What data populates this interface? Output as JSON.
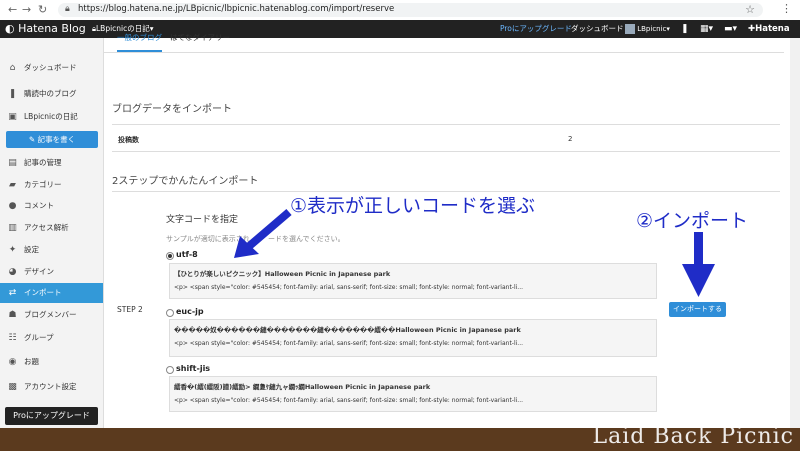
{
  "browser": {
    "url": "https://blog.hatena.ne.jp/LBpicnic/lbpicnic.hatenablog.com/import/reserve"
  },
  "header": {
    "logo": "Hatena Blog",
    "blog_name": "LBpicnicの日記",
    "pro_upgrade": "Proにアップグレード",
    "dashboard": "ダッシュボード",
    "user": "LBpicnic",
    "hatena": "Hatena"
  },
  "sidebar": {
    "items": [
      {
        "label": "ダッシュボード",
        "icon": "home-icon"
      },
      {
        "label": "購読中のブログ",
        "icon": "bookmark-icon"
      },
      {
        "label": "LBpicnicの日記",
        "icon": "blog-icon"
      },
      {
        "label": "記事の管理",
        "icon": "document-icon"
      },
      {
        "label": "カテゴリー",
        "icon": "folder-icon"
      },
      {
        "label": "コメント",
        "icon": "comment-icon"
      },
      {
        "label": "アクセス解析",
        "icon": "chart-icon"
      },
      {
        "label": "設定",
        "icon": "wrench-icon"
      },
      {
        "label": "デザイン",
        "icon": "palette-icon"
      },
      {
        "label": "インポート",
        "icon": "import-icon"
      },
      {
        "label": "ブログメンバー",
        "icon": "members-icon"
      },
      {
        "label": "グループ",
        "icon": "group-icon"
      },
      {
        "label": "お題",
        "icon": "topic-icon"
      },
      {
        "label": "アカウント設定",
        "icon": "account-icon"
      }
    ],
    "write_button": "記事を書く",
    "pro_button": "Proにアップグレード"
  },
  "main": {
    "tabs": [
      "一般のブログ",
      "はてなダイアリー"
    ],
    "section_title": "ブログデータをインポート",
    "post_count_label": "投稿数",
    "post_count_value": "2",
    "steps_title": "2ステップでかんたんインポート",
    "step_label": "STEP 2",
    "encoding_title": "文字コードを指定",
    "encoding_help_a": "サンプルが適切に表示され",
    "encoding_help_b": "ードを選んでください。",
    "options": [
      {
        "label": "utf-8",
        "selected": true,
        "title_line": "【ひとりが楽しいピクニック】Halloween Picnic in Japanese park",
        "html_line": "<p> <span style=\"color: #545454; font-family: arial, sans-serif; font-size: small; font-style: normal; font-variant-li..."
      },
      {
        "label": "euc-jp",
        "selected": false,
        "title_line": "�����奴������縺�������縺�������繧��Halloween Picnic in Japanese park",
        "html_line": "<p> <span style=\"color: #545454; font-family: arial, sans-serif; font-size: small; font-style: normal; font-variant-li..."
      },
      {
        "label": "shift-jis",
        "selected": false,
        "title_line": "繧香�(繧(繧阪)譜)繧励> 繝夐ｹ縺九ャ繝ｯ繝Halloween Picnic in Japanese park",
        "html_line": "<p> <span style=\"color: #545454; font-family: arial, sans-serif; font-size: small; font-style: normal; font-variant-li..."
      }
    ],
    "import_button": "インポートする"
  },
  "annotations": {
    "left": "①表示が正しいコードを選ぶ",
    "right": "②インポート",
    "color": "#1f2cc7"
  },
  "footer": {
    "brand": "Laid Back Picnic"
  }
}
